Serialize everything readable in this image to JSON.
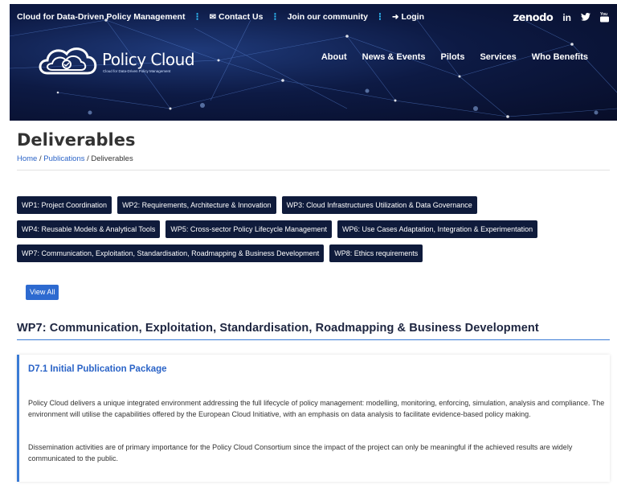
{
  "topbar": {
    "site_name": "Cloud for Data-Driven Policy Management",
    "contact_label": "Contact Us",
    "community_label": "Join our community",
    "login_label": "Login"
  },
  "social": {
    "zenodo": "zenodo",
    "linkedin": "in",
    "twitter_icon": "twitter-bird",
    "youtube_icon": "youtube"
  },
  "logo": {
    "name": "Policy Cloud",
    "tagline": "Cloud for Data-Driven Policy Management"
  },
  "nav": {
    "about": "About",
    "news": "News & Events",
    "pilots": "Pilots",
    "services": "Services",
    "who_benefits": "Who Benefits"
  },
  "page": {
    "title": "Deliverables",
    "breadcrumb": {
      "home": "Home",
      "sep1": " / ",
      "publications": "Publications",
      "sep2": " / ",
      "current": "Deliverables"
    }
  },
  "work_packages": [
    "WP1: Project Coordination",
    "WP2: Requirements, Architecture & Innovation",
    "WP3: Cloud Infrastructures Utilization & Data Governance",
    "WP4: Reusable Models & Analytical Tools",
    "WP5: Cross-sector Policy Lifecycle Management",
    "WP6: Use Cases Adaptation, Integration & Experimentation",
    "WP7: Communication, Exploitation, Standardisation, Roadmapping & Business Development",
    "WP8: Ethics requirements"
  ],
  "view_all_label": "View All",
  "section": {
    "title": "WP7: Communication, Exploitation, Standardisation, Roadmapping & Business Development"
  },
  "deliverable": {
    "title": "D7.1 Initial Publication Package",
    "paragraph1": "Policy Cloud delivers a unique integrated environment addressing the full lifecycle of policy management: modelling, monitoring, enforcing, simulation, analysis and compliance. The environment will utilise the capabilities offered by the European Cloud Initiative, with an emphasis on data analysis to facilitate evidence-based policy making.",
    "paragraph2": "Dissemination activities are of primary importance for the Policy Cloud Consortium since the impact of the project can only be meaningful if the achieved results are widely communicated to the public."
  },
  "colors": {
    "header_bg": "#0d1a44",
    "tag_bg": "#0f1b3b",
    "accent_blue": "#2d6ad0",
    "separator_cyan": "#2fc3ff"
  }
}
